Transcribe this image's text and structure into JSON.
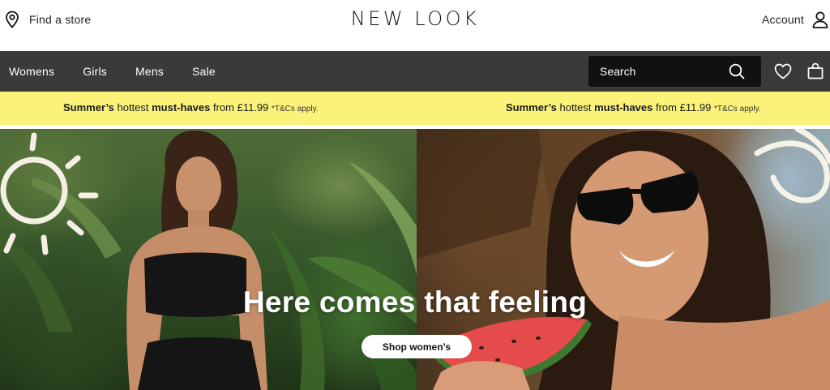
{
  "header": {
    "find_store_label": "Find a store",
    "logo_text": "NEW LOOK",
    "account_label": "Account"
  },
  "nav": {
    "links": [
      "Womens",
      "Girls",
      "Mens",
      "Sale"
    ],
    "search_placeholder": "Search"
  },
  "promo": {
    "messages": [
      {
        "part1": "Summer’s",
        "part2": " hottest ",
        "part3": "must-haves",
        "part4": " from £11.99 ",
        "tc": "*T&Cs apply."
      },
      {
        "part1": "Summer’s",
        "part2": " hottest ",
        "part3": "must-haves",
        "part4": " from £11.99 ",
        "tc": "*T&Cs apply."
      }
    ],
    "background_color": "#fbf27a"
  },
  "hero": {
    "title": "Here comes that feeling",
    "button_label": "Shop women’s",
    "left_image": "woman-in-black-bandeau-outfit-among-tropical-plants",
    "right_image": "woman-in-sunglasses-eating-watermelon"
  },
  "icons": {
    "find_store": "location-pin-icon",
    "account": "user-icon",
    "search": "search-icon",
    "wishlist": "heart-icon",
    "bag": "shopping-bag-icon"
  },
  "colors": {
    "nav_background": "#3a3a3a",
    "search_background": "#111111"
  }
}
